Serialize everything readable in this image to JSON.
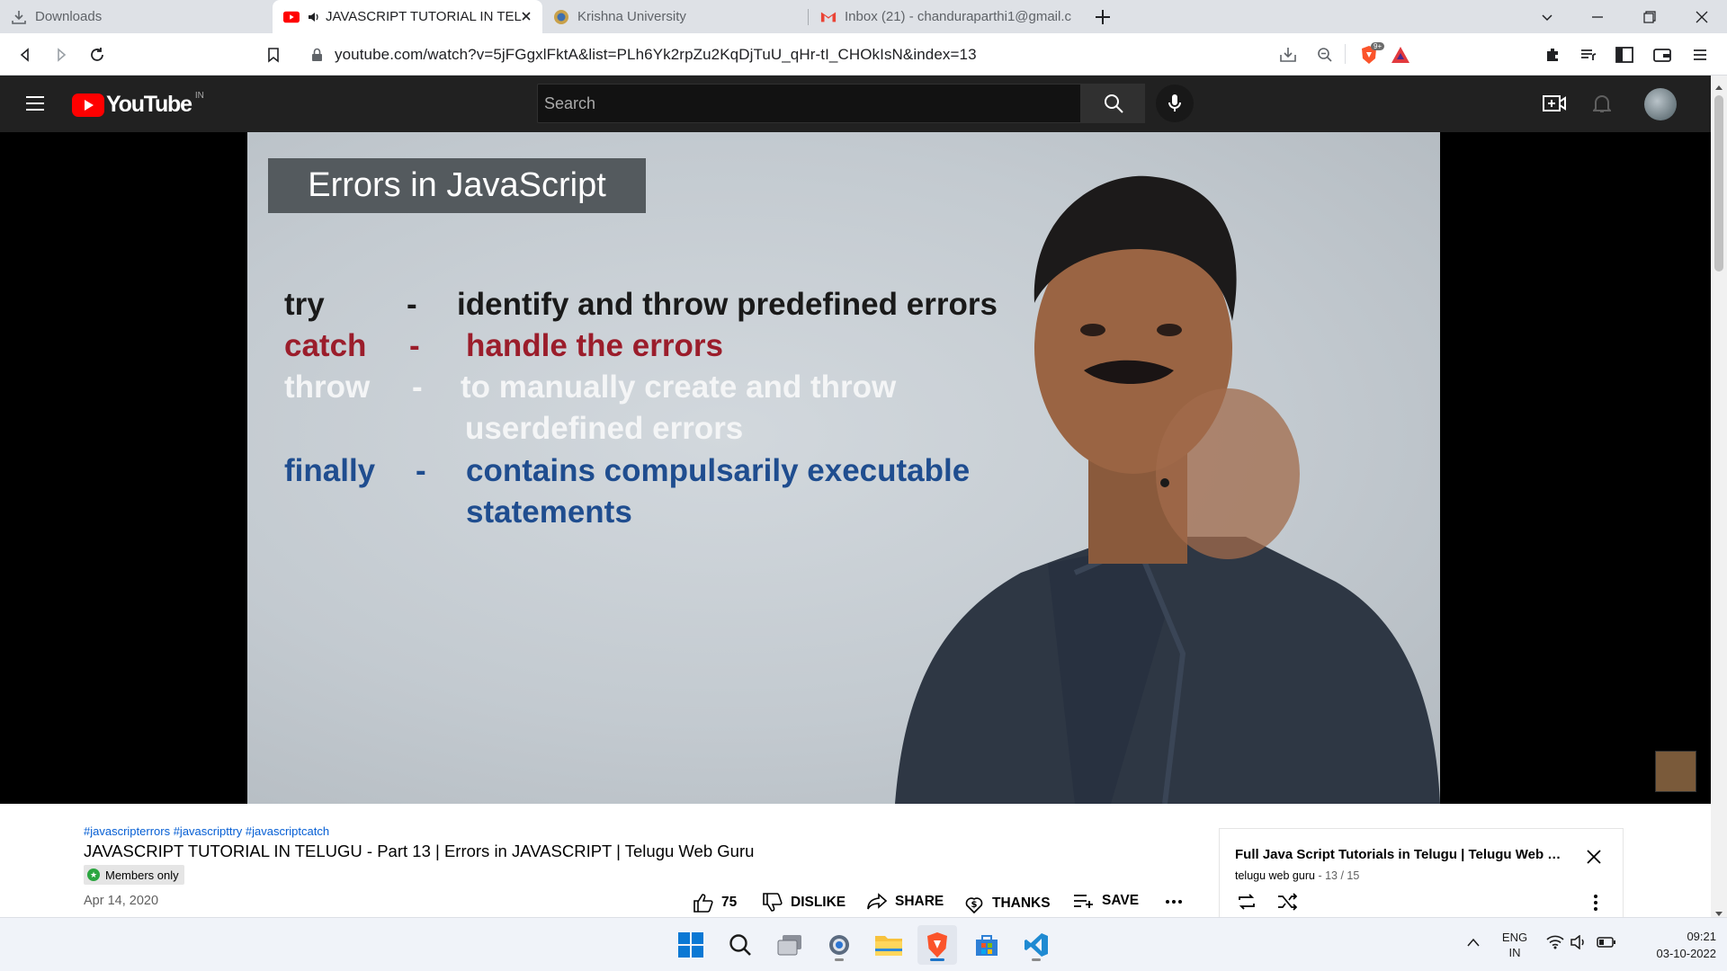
{
  "browser": {
    "tabs": [
      {
        "title": "Downloads",
        "icon": "download-icon"
      },
      {
        "title": "JAVASCRIPT TUTORIAL IN TELU",
        "icon": "youtube-icon",
        "audio": true,
        "active": true
      },
      {
        "title": "Krishna University",
        "icon": "university-icon"
      },
      {
        "title": "Inbox (21) - chanduraparthi1@gmail.c",
        "icon": "gmail-icon"
      }
    ],
    "url": "youtube.com/watch?v=5jFGgxlFktA&list=PLh6Yk2rpZu2KqDjTuU_qHr-tI_CHOkIsN&index=13"
  },
  "youtube": {
    "logo_text": "YouTube",
    "region": "IN",
    "search_placeholder": "Search"
  },
  "slide": {
    "title": "Errors in JavaScript",
    "rows": [
      {
        "keyword": "try",
        "dash": "-",
        "text": "identify and throw predefined errors",
        "color": "black"
      },
      {
        "keyword": "catch",
        "dash": "-",
        "text": "handle the errors",
        "color": "red"
      },
      {
        "keyword": "throw",
        "dash": "-",
        "text": "to manually create and throw",
        "color": "white"
      },
      {
        "keyword": "",
        "dash": "",
        "text": "userdefined  errors",
        "color": "white"
      },
      {
        "keyword": "finally",
        "dash": "-",
        "text": "contains compulsarily  executable",
        "color": "blue"
      },
      {
        "keyword": "",
        "dash": "",
        "text": "statements",
        "color": "blue"
      }
    ]
  },
  "video": {
    "hashtags": "#javascripterrors #javascripttry #javascriptcatch",
    "title": "JAVASCRIPT TUTORIAL IN TELUGU - Part 13 | Errors in JAVASCRIPT | Telugu Web Guru",
    "members_badge": "Members only",
    "date": "Apr 14, 2020",
    "likes": "75",
    "dislike_label": "DISLIKE",
    "share_label": "SHARE",
    "thanks_label": "THANKS",
    "save_label": "SAVE"
  },
  "playlist": {
    "title": "Full Java Script Tutorials in Telugu | Telugu Web Gu...",
    "channel": "telugu web guru",
    "position": "- 13 / 15"
  },
  "taskbar": {
    "lang_line1": "ENG",
    "lang_line2": "IN",
    "time": "09:21",
    "date": "03-10-2022"
  },
  "colors": {
    "youtube_red": "#ff0000",
    "slide_red": "#9b1d2b",
    "slide_blue": "#1f4d8f",
    "link_blue": "#065fd4"
  }
}
